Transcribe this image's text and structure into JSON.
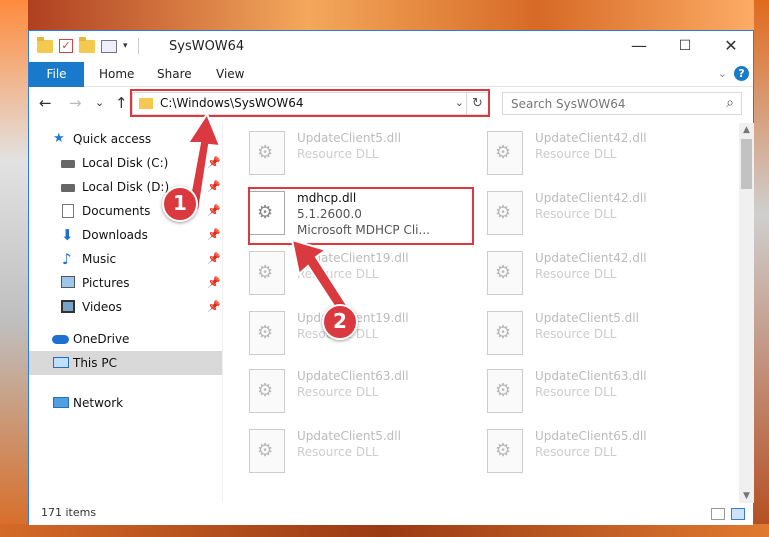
{
  "window": {
    "title": "SysWOW64",
    "controls": {
      "minimize": "—",
      "maximize": "☐",
      "close": "✕"
    }
  },
  "ribbon": {
    "file": "File",
    "tabs": [
      "Home",
      "Share",
      "View"
    ],
    "help": "?"
  },
  "nav": {
    "back": "←",
    "forward": "→",
    "recent": "⌄",
    "up": "↑",
    "address": "C:\\Windows\\SysWOW64",
    "address_dropdown": "⌄",
    "refresh": "↻",
    "search_placeholder": "Search SysWOW64",
    "search_glyph": "⌕"
  },
  "sidebar": {
    "items": [
      {
        "label": "Quick access",
        "icon": "star-icon"
      },
      {
        "label": "Local Disk (C:)",
        "icon": "drive-icon",
        "pinned": true
      },
      {
        "label": "Local Disk (D:)",
        "icon": "drive-icon",
        "pinned": true
      },
      {
        "label": "Documents",
        "icon": "documents-icon",
        "pinned": true
      },
      {
        "label": "Downloads",
        "icon": "download-icon",
        "pinned": true
      },
      {
        "label": "Music",
        "icon": "music-icon",
        "pinned": true
      },
      {
        "label": "Pictures",
        "icon": "pictures-icon",
        "pinned": true
      },
      {
        "label": "Videos",
        "icon": "videos-icon",
        "pinned": true
      },
      {
        "label": "OneDrive",
        "icon": "cloud-icon"
      },
      {
        "label": "This PC",
        "icon": "computer-icon",
        "selected": true
      },
      {
        "label": "Network",
        "icon": "network-icon"
      }
    ],
    "pin_glyph": "📌"
  },
  "files": [
    {
      "name": "UpdateClient5.dll",
      "desc": "Resource DLL"
    },
    {
      "name": "UpdateClient42.dll",
      "desc": "Resource DLL"
    },
    {
      "name": "mdhcp.dll",
      "version": "5.1.2600.0",
      "desc": "Microsoft MDHCP Cli...",
      "highlighted": true
    },
    {
      "name": "UpdateClient42.dll",
      "desc": "Resource DLL"
    },
    {
      "name": "UpdateClient19.dll",
      "desc": "Resource DLL"
    },
    {
      "name": "UpdateClient42.dll",
      "desc": "Resource DLL"
    },
    {
      "name": "UpdateClient19.dll",
      "desc": "Resource DLL"
    },
    {
      "name": "UpdateClient5.dll",
      "desc": "Resource DLL"
    },
    {
      "name": "UpdateClient63.dll",
      "desc": "Resource DLL"
    },
    {
      "name": "UpdateClient63.dll",
      "desc": "Resource DLL"
    },
    {
      "name": "UpdateClient5.dll",
      "desc": "Resource DLL"
    },
    {
      "name": "UpdateClient65.dll",
      "desc": "Resource DLL"
    }
  ],
  "status": {
    "item_count": "171 items"
  },
  "annotations": {
    "step1": "1",
    "step2": "2",
    "color": "#d9393f"
  }
}
